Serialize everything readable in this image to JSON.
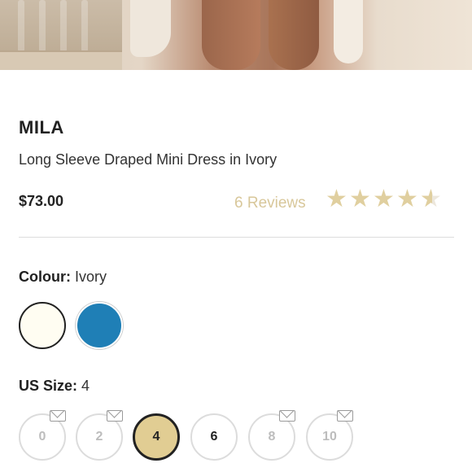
{
  "product": {
    "brand": "MILA",
    "name": "Long Sleeve Draped Mini Dress in Ivory",
    "price": "$73.00",
    "reviews_text": "6 Reviews",
    "rating": 4.5,
    "rating_max": 5
  },
  "colour": {
    "label": "Colour:",
    "value": "Ivory",
    "options": [
      {
        "name": "ivory",
        "hex": "#fffdf2",
        "selected": true
      },
      {
        "name": "blue",
        "hex": "#1f7fb6",
        "selected": false
      }
    ]
  },
  "size": {
    "label": "US Size:",
    "value": "4",
    "options": [
      {
        "label": "0",
        "available": false,
        "notify": true
      },
      {
        "label": "2",
        "available": false,
        "notify": true
      },
      {
        "label": "4",
        "available": true,
        "selected": true
      },
      {
        "label": "6",
        "available": true
      },
      {
        "label": "8",
        "available": false,
        "notify": true
      },
      {
        "label": "10",
        "available": false,
        "notify": true
      }
    ]
  },
  "colors": {
    "accent_gold": "#e1cd93",
    "star_gold": "#e0cf9f",
    "reviews_text": "#d8c79a"
  }
}
